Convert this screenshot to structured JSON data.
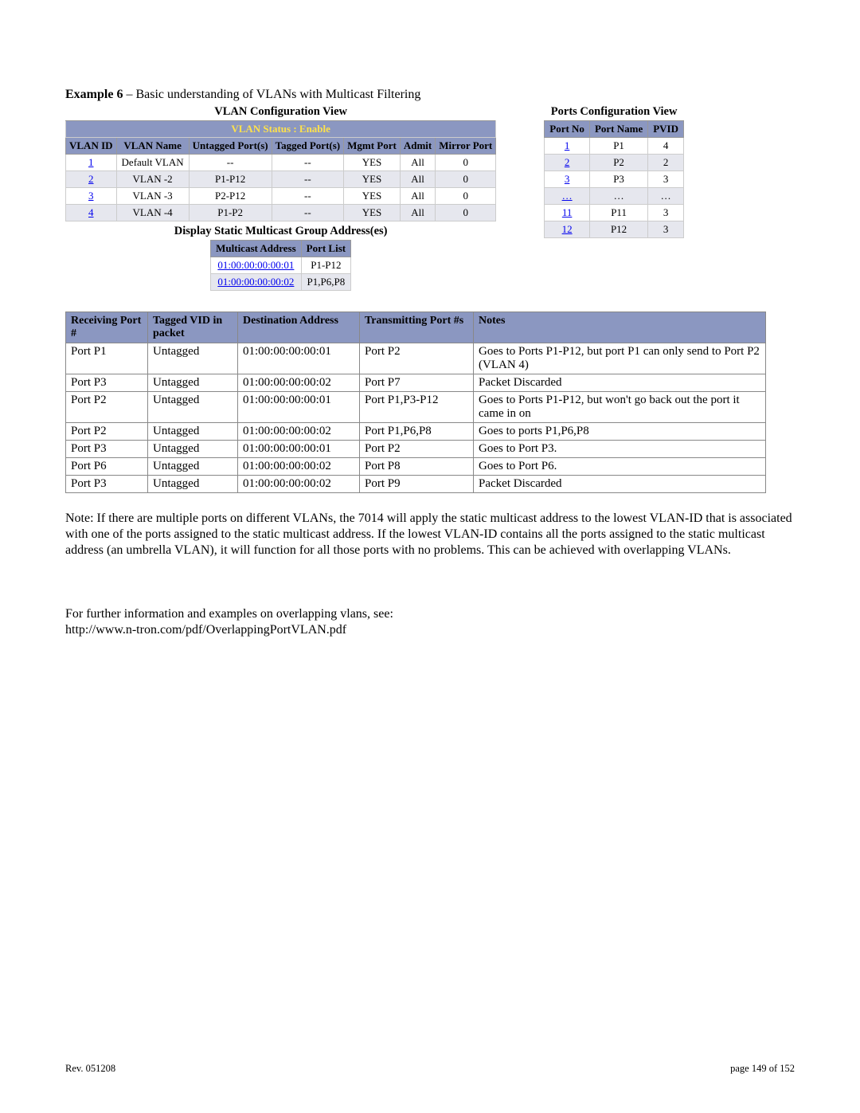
{
  "title_prefix": "Example 6",
  "title_rest": " – Basic understanding of VLANs with Multicast Filtering",
  "vlan_section_title": "VLAN Configuration View",
  "ports_section_title": "Ports Configuration View",
  "vlan_status_label": "VLAN Status   :   Enable",
  "vlan_headers": {
    "id": "VLAN ID",
    "name": "VLAN Name",
    "untagged": "Untagged Port(s)",
    "tagged": "Tagged Port(s)",
    "mgmt": "Mgmt Port",
    "admit": "Admit",
    "mirror": "Mirror Port"
  },
  "vlan_rows": [
    {
      "id": "1",
      "name": "Default VLAN",
      "untag": "--",
      "tag": "--",
      "mgmt": "YES",
      "admit": "All",
      "mirror": "0"
    },
    {
      "id": "2",
      "name": "VLAN -2",
      "untag": "P1-P12",
      "tag": "--",
      "mgmt": "YES",
      "admit": "All",
      "mirror": "0"
    },
    {
      "id": "3",
      "name": "VLAN -3",
      "untag": "P2-P12",
      "tag": "--",
      "mgmt": "YES",
      "admit": "All",
      "mirror": "0"
    },
    {
      "id": "4",
      "name": "VLAN -4",
      "untag": "P1-P2",
      "tag": "--",
      "mgmt": "YES",
      "admit": "All",
      "mirror": "0"
    }
  ],
  "mcast_title": "Display Static Multicast Group Address(es)",
  "mcast_headers": {
    "addr": "Multicast Address",
    "ports": "Port List"
  },
  "mcast_rows": [
    {
      "addr": "01:00:00:00:00:01",
      "ports": "P1-P12"
    },
    {
      "addr": "01:00:00:00:00:02",
      "ports": "P1,P6,P8"
    }
  ],
  "ports_headers": {
    "no": "Port No",
    "name": "Port Name",
    "pvid": "PVID"
  },
  "ports_rows": [
    {
      "no": "1",
      "name": "P1",
      "pvid": "4"
    },
    {
      "no": "2",
      "name": "P2",
      "pvid": "2"
    },
    {
      "no": "3",
      "name": "P3",
      "pvid": "3"
    },
    {
      "no": "…",
      "name": "…",
      "pvid": "…"
    },
    {
      "no": "11",
      "name": "P11",
      "pvid": "3"
    },
    {
      "no": "12",
      "name": "P12",
      "pvid": "3"
    }
  ],
  "scenario_headers": {
    "recv": "Receiving Port #",
    "vid": "Tagged VID in packet",
    "dest": "Destination Address",
    "tx": "Transmitting Port #s",
    "notes": "Notes"
  },
  "scenario_rows": [
    {
      "recv": "Port P1",
      "vid": "Untagged",
      "dest": "01:00:00:00:00:01",
      "tx": "Port P2",
      "notes": "Goes to Ports P1-P12, but port P1 can only send to Port P2 (VLAN 4)"
    },
    {
      "recv": "Port P3",
      "vid": "Untagged",
      "dest": "01:00:00:00:00:02",
      "tx": "Port P7",
      "notes": "Packet Discarded"
    },
    {
      "recv": "Port P2",
      "vid": "Untagged",
      "dest": "01:00:00:00:00:01",
      "tx": "Port P1,P3-P12",
      "notes": "Goes to Ports P1-P12, but won't go back out the port it came in on"
    },
    {
      "recv": "Port P2",
      "vid": "Untagged",
      "dest": "01:00:00:00:00:02",
      "tx": "Port P1,P6,P8",
      "notes": "Goes to ports P1,P6,P8"
    },
    {
      "recv": "Port P3",
      "vid": "Untagged",
      "dest": "01:00:00:00:00:01",
      "tx": "Port P2",
      "notes": "Goes to Port P3."
    },
    {
      "recv": "Port P6",
      "vid": "Untagged",
      "dest": "01:00:00:00:00:02",
      "tx": "Port P8",
      "notes": "Goes to Port P6."
    },
    {
      "recv": "Port P3",
      "vid": "Untagged",
      "dest": "01:00:00:00:00:02",
      "tx": "Port P9",
      "notes": "Packet Discarded"
    }
  ],
  "note_text": "Note: If there are multiple ports on different VLANs, the 7014 will apply the static multicast address to the lowest VLAN-ID that is associated with one of the ports assigned to the static multicast address.  If the lowest VLAN-ID contains all the ports assigned to the static multicast address (an umbrella VLAN), it will function for all those ports with no problems.  This can be achieved with overlapping VLANs.",
  "further_line1": "For further information and examples on overlapping vlans, see:",
  "further_line2": "http://www.n-tron.com/pdf/OverlappingPortVLAN.pdf",
  "footer_left": "Rev.  051208",
  "footer_right": "page 149 of 152"
}
